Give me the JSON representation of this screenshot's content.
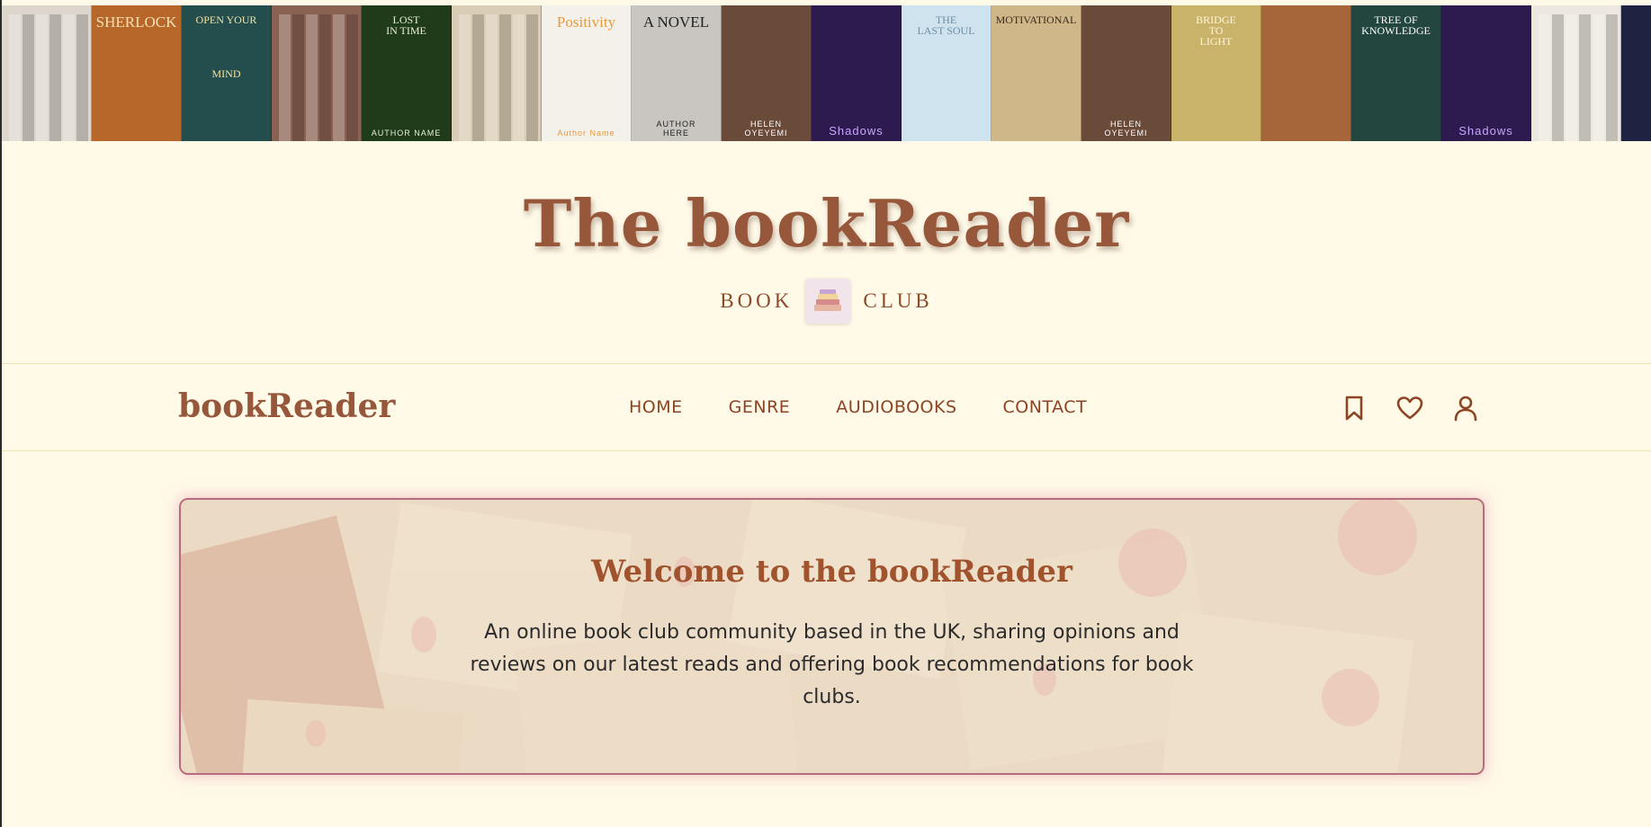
{
  "book_strip": [
    {
      "name": "book-stack-photo",
      "title": "",
      "author": "",
      "bg": "#ddd6cc",
      "color": "#5a3a22"
    },
    {
      "name": "sherlock-cover",
      "title": "SHERLOCK",
      "author": "",
      "bg": "#b7672a",
      "color": "#f6e0b0"
    },
    {
      "name": "open-your-mind-cover",
      "title": "OPEN YOUR\n\n\n\n\nMIND",
      "author": "",
      "bg": "#244e4d",
      "color": "#f3e2a1"
    },
    {
      "name": "old-books-photo",
      "title": "",
      "author": "",
      "bg": "#8a6252",
      "color": "#e8d6c8"
    },
    {
      "name": "lost-in-time-cover",
      "title": "LOST\nIN TIME",
      "author": "AUTHOR NAME",
      "bg": "#1f3b1a",
      "color": "#e8f0d4"
    },
    {
      "name": "book-spines-photo",
      "title": "",
      "author": "",
      "bg": "#d9cdb5",
      "color": "#5a4a38"
    },
    {
      "name": "positivity-cover",
      "title": "Positivity",
      "author": "Author Name",
      "bg": "#f4f1ea",
      "color": "#e89a3b"
    },
    {
      "name": "a-novel-cover",
      "title": "A NOVEL",
      "author": "AUTHOR\nHERE",
      "bg": "#c9c6c2",
      "color": "#222222"
    },
    {
      "name": "helen-oyeyemi-cover-1",
      "title": "",
      "author": "HELEN\nOYEYEMI",
      "bg": "#6a4a38",
      "color": "#ffffff"
    },
    {
      "name": "avenging-shadows-cover-1",
      "title": "",
      "author": "Shadows",
      "bg": "#2d1a4e",
      "color": "#c8a6ff"
    },
    {
      "name": "the-last-soul-cover",
      "title": "THE\nLAST SOUL",
      "author": "",
      "bg": "#cfe3ef",
      "color": "#6a8fa8"
    },
    {
      "name": "motivational-cover",
      "title": "MOTIVATIONAL",
      "author": "",
      "bg": "#cfb78a",
      "color": "#3a2a18"
    },
    {
      "name": "helen-oyeyemi-cover-2",
      "title": "",
      "author": "HELEN\nOYEYEMI",
      "bg": "#6a4a38",
      "color": "#ffffff"
    },
    {
      "name": "bridge-to-light-cover",
      "title": "BRIDGE\nTO\nLIGHT",
      "author": "",
      "bg": "#c9b36a",
      "color": "#fff6d8"
    },
    {
      "name": "hands-cover",
      "title": "",
      "author": "",
      "bg": "#a6663a",
      "color": "#f7dcbc"
    },
    {
      "name": "tree-of-knowledge-cover",
      "title": "TREE OF\nKNOWLEDGE",
      "author": "",
      "bg": "#23463e",
      "color": "#ffffff"
    },
    {
      "name": "avenging-shadows-cover-2",
      "title": "",
      "author": "Shadows",
      "bg": "#2d1a4e",
      "color": "#c8a6ff"
    },
    {
      "name": "white-books-photo",
      "title": "",
      "author": "",
      "bg": "#ece7df",
      "color": "#8a7a66"
    },
    {
      "name": "dark-cover-partial",
      "title": "",
      "author": "",
      "bg": "#1d2340",
      "color": "#9aa6ff"
    }
  ],
  "header": {
    "title": "The bookReader",
    "subtitle_left": "BOOK",
    "subtitle_right": "CLUB"
  },
  "nav": {
    "brand": "bookReader",
    "links": [
      "HOME",
      "GENRE",
      "AUDIOBOOKS",
      "CONTACT"
    ]
  },
  "hero": {
    "title": "Welcome to the bookReader",
    "text": "An online book club community based in the UK, sharing opinions and reviews on our latest reads and offering book recommendations for book clubs."
  },
  "colors": {
    "brand_brown": "#97573a",
    "nav_text": "#8b4524",
    "page_bg": "#fff9e8",
    "hero_border": "#b76c7d"
  }
}
